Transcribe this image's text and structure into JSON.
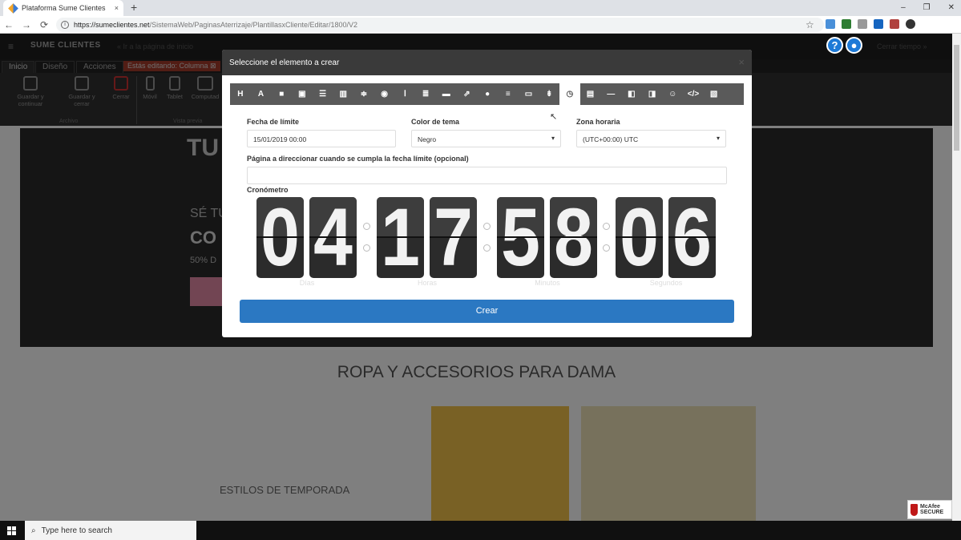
{
  "browser": {
    "tab_title": "Plataforma Sume Clientes",
    "tab_close": "×",
    "new_tab": "+",
    "url_host": "https://sumeclientes.net",
    "url_path": "/SistemaWeb/PaginasAterrizaje/PlantillasxCliente/Editar/1800/V2",
    "back": "←",
    "forward": "→",
    "reload": "⟳",
    "star": "☆",
    "win_min": "–",
    "win_max": "❐",
    "win_close": "✕"
  },
  "app": {
    "menu_icon": "≡",
    "logo": "SUME CLIENTES",
    "back_link": "« Ir a la página de inicio",
    "logout": "Cerrar tiempo »",
    "help_icon": "?",
    "chat_icon": "●",
    "tabs": [
      "Inicio",
      "Diseño",
      "Acciones"
    ],
    "editing_badge": "Estás editando: Columna ⊠",
    "ribbon": {
      "save_continue": "Guardar y continuar",
      "save_close": "Guardar y cerrar",
      "close": "Cerrar",
      "mobile": "Móvil",
      "tablet": "Tablet",
      "computer": "Computad",
      "group_archivo": "Archivo",
      "group_vista": "Vista previa"
    }
  },
  "background": {
    "hero_title": "TU",
    "hero_line1": "SÉ TU",
    "hero_line2": "CO",
    "hero_line3": "50% D",
    "section_title": "ROPA Y ACCESORIOS PARA DAMA",
    "estilos": "ESTILOS DE TEMPORADA",
    "mcafee": "McAfee SECURE"
  },
  "modal": {
    "title": "Seleccione el elemento a crear",
    "close": "×",
    "toolbar_icons": [
      "H",
      "A",
      "■",
      "▣",
      "☰",
      "▥",
      "≑",
      "◉",
      "Ⅰ",
      "≣",
      "▬",
      "⇗",
      "●",
      "≡",
      "▭",
      "⇟",
      "◷",
      "▤",
      "—",
      "◧",
      "◨",
      "☺",
      "</>",
      "▧"
    ],
    "selected_index": 16,
    "fecha_label": "Fecha de límite",
    "fecha_value": "15/01/2019 00:00",
    "color_label": "Color de tema",
    "color_value": "Negro",
    "zona_label": "Zona horaria",
    "zona_value": "(UTC+00:00) UTC",
    "redirect_label": "Página a direccionar cuando se cumpla la fecha límite (opcional)",
    "redirect_value": "",
    "cronometro_label": "Cronómetro",
    "digits": [
      "0",
      "4",
      "1",
      "7",
      "5",
      "8",
      "0",
      "6"
    ],
    "units": [
      "Días",
      "Horas",
      "Minutos",
      "Segundos"
    ],
    "create_button": "Crear",
    "select_arrow": "▾"
  },
  "taskbar": {
    "search_placeholder": "Type here to search",
    "search_icon": "⌕"
  }
}
